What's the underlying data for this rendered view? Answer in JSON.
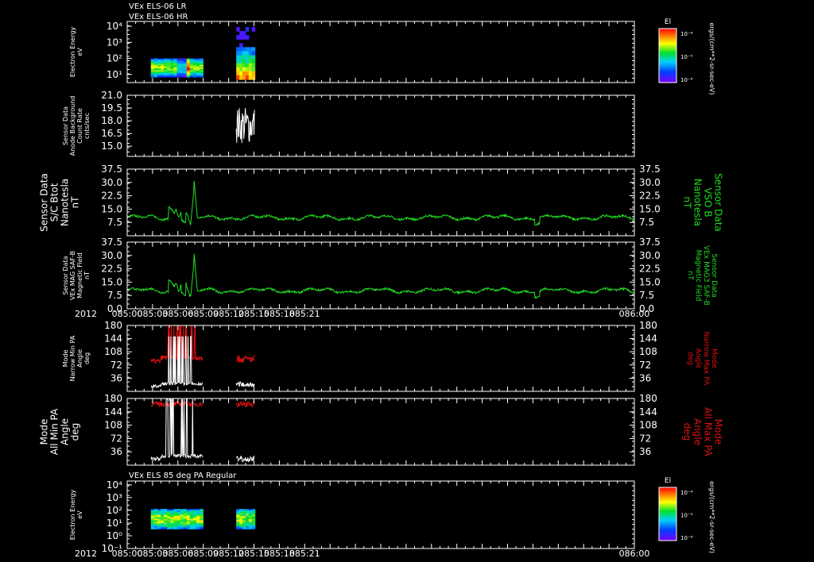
{
  "header": {
    "lines": [
      "VEx ELS-06 LR",
      "VEx ELS-06 HR"
    ]
  },
  "colors": {
    "background": "#000000",
    "axis": "#ffffff",
    "mag": "#22dd22",
    "max_pa": "#dd1111",
    "min_pa": "#ffffff"
  },
  "colorbar": {
    "label": "El",
    "units": "ergs/(cm**2-sr-sec-eV)",
    "ticks": [
      "10⁻⁴",
      "10⁻⁵",
      "10⁻⁶"
    ]
  },
  "time_axis": {
    "tick_labels": [
      "085:00",
      "085:03",
      "085:06",
      "085:09",
      "085:12",
      "085:15",
      "085:18",
      "085:21",
      "086:00"
    ],
    "year_label": "2012"
  },
  "panel_titles": {
    "p7": "VEx ELS 85 deg PA Regular"
  },
  "chart_data": [
    {
      "id": "p1",
      "type": "heatmap",
      "left_label": [
        "Electron Energy",
        "eV"
      ],
      "y_ticks": [
        "10⁴",
        "10³",
        "10²",
        "10¹"
      ],
      "y_tick_pos": [
        4,
        3,
        2,
        1
      ],
      "ylim": [
        0.5,
        4.3
      ],
      "log": true,
      "blocks": [
        {
          "t0": 2.8,
          "t1": 8.95,
          "style": "wide"
        },
        {
          "t0": 12.9,
          "t1": 15.1,
          "style": "dense"
        }
      ]
    },
    {
      "id": "p2",
      "type": "line",
      "left_label": [
        "Sensor Data",
        "Anode Background",
        "Count Rate",
        "cnts/sec"
      ],
      "y_ticks": [
        "21.0",
        "19.5",
        "18.0",
        "16.5",
        "15.0"
      ],
      "y_tick_pos": [
        21,
        19.5,
        18,
        16.5,
        15
      ],
      "ylim": [
        13.8,
        21
      ],
      "series": [
        {
          "name": "",
          "color": "min_pa",
          "segments": [
            [
              12.9,
              15.1,
              17.5,
              2.2
            ]
          ]
        }
      ]
    },
    {
      "id": "p3",
      "type": "line",
      "left_label": [
        "Sensor Data",
        "S/C Btot",
        "Nanotesla",
        "nT"
      ],
      "right_label": [
        "Sensor Data",
        "VSO B",
        "Nanotesla",
        "nT"
      ],
      "y_ticks": [
        "37.5",
        "30.0",
        "22.5",
        "15.0",
        "7.5"
      ],
      "y_tick_pos": [
        37.5,
        30,
        22.5,
        15,
        7.5
      ],
      "ylim": [
        0,
        37.5
      ],
      "series": [
        {
          "name": "",
          "color": "mag",
          "profile": "mag"
        }
      ]
    },
    {
      "id": "p4",
      "type": "line",
      "left_label": [
        "Sensor Data",
        "VEx MAG SAF-B",
        "Magnetic Field",
        "nT"
      ],
      "right_label": [
        "Sensor Data",
        "VEx MAG3 SAF-B",
        "Magnetic Field",
        "nT"
      ],
      "y_ticks": [
        "37.5",
        "30.0",
        "22.5",
        "15.0",
        "7.5",
        "0.0"
      ],
      "y_tick_pos": [
        37.5,
        30,
        22.5,
        15,
        7.5,
        0
      ],
      "ylim": [
        0,
        37.5
      ],
      "series": [
        {
          "name": "",
          "color": "mag",
          "profile": "mag"
        }
      ]
    },
    {
      "id": "p5",
      "type": "line",
      "left_label": [
        "Mode",
        "Narrow Min PA",
        "Angle",
        "deg"
      ],
      "right_label": [
        "Mode",
        "Narrow Max PA",
        "Angle",
        "deg"
      ],
      "y_ticks": [
        "180",
        "144",
        "108",
        "72",
        "36"
      ],
      "y_tick_pos": [
        180,
        144,
        108,
        72,
        36
      ],
      "ylim": [
        0,
        180
      ],
      "series": [
        {
          "name": "",
          "color": "max_pa",
          "profile": "narrow_max"
        },
        {
          "name": "",
          "color": "min_pa",
          "profile": "narrow_min"
        }
      ]
    },
    {
      "id": "p6",
      "type": "line",
      "left_label": [
        "Mode",
        "All Min PA",
        "Angle",
        "deg"
      ],
      "right_label": [
        "Mode",
        "All Max PA",
        "Angle",
        "deg"
      ],
      "y_ticks": [
        "180",
        "144",
        "108",
        "72",
        "36"
      ],
      "y_tick_pos": [
        180,
        144,
        108,
        72,
        36
      ],
      "ylim": [
        0,
        180
      ],
      "series": [
        {
          "name": "",
          "color": "max_pa",
          "profile": "all_max"
        },
        {
          "name": "",
          "color": "min_pa",
          "profile": "all_min"
        }
      ]
    },
    {
      "id": "p7",
      "type": "heatmap",
      "left_label": [
        "Electron Energy",
        "eV"
      ],
      "y_ticks": [
        "10⁴",
        "10³",
        "10²",
        "10¹",
        "10⁰",
        "10⁻¹"
      ],
      "y_tick_pos": [
        4,
        3,
        2,
        1,
        0,
        -1
      ],
      "ylim": [
        -1,
        4.3
      ],
      "log": true,
      "blocks": [
        {
          "t0": 2.8,
          "t1": 8.95,
          "style": "pa85"
        },
        {
          "t0": 12.9,
          "t1": 15.1,
          "style": "pa85b"
        }
      ]
    }
  ]
}
